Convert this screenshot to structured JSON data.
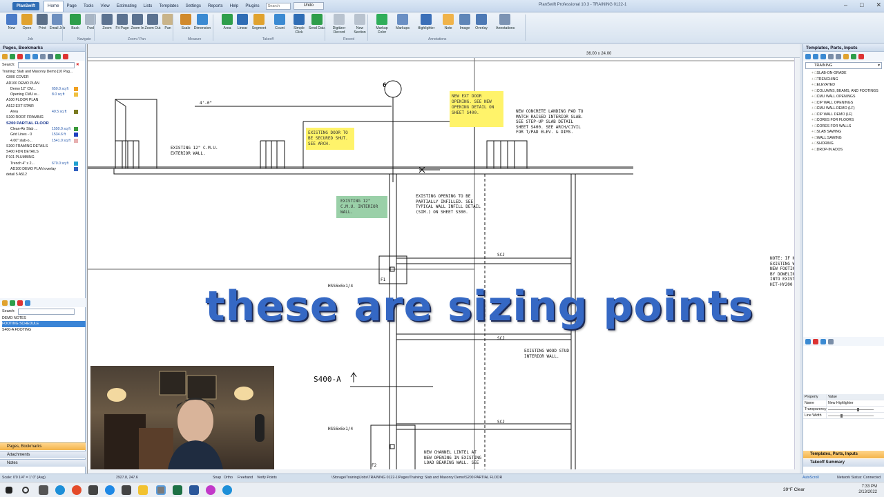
{
  "window": {
    "app_button": "PlanSwift",
    "title": "PlanSwift Professional 10.3 - TRAINING 0122-1",
    "menu": [
      "Home",
      "Page",
      "Tools",
      "View",
      "Estimating",
      "Lists",
      "Templates",
      "Settings",
      "Reports",
      "Help",
      "Plugins"
    ],
    "search_placeholder": "Search",
    "undo_label": "Undo"
  },
  "ribbon": {
    "buttons": [
      {
        "label": "New",
        "color": "#4a7bc8"
      },
      {
        "label": "Open",
        "color": "#e0a22e"
      },
      {
        "label": "Print",
        "color": "#5b6f88"
      },
      {
        "label": "Email Job",
        "color": "#6d8fbf"
      },
      {
        "label": "Back",
        "color": "#2e9e4a"
      },
      {
        "label": "Fwd",
        "color": "#a9b6c5"
      },
      {
        "label": "Zoom",
        "color": "#5b7290"
      },
      {
        "label": "Fit Page",
        "color": "#5b7290"
      },
      {
        "label": "Zoom In",
        "color": "#5b7290"
      },
      {
        "label": "Zoom Out",
        "color": "#5b7290"
      },
      {
        "label": "Pan",
        "color": "#c9b48a"
      },
      {
        "label": "Scale",
        "color": "#d18a2c"
      },
      {
        "label": "Dimension",
        "color": "#3b8ad2"
      },
      {
        "label": "Area",
        "color": "#2e9e4a"
      },
      {
        "label": "Linear",
        "color": "#2f6db5"
      },
      {
        "label": "Segment",
        "color": "#e0a22e"
      },
      {
        "label": "Count",
        "color": "#3b8ad2"
      },
      {
        "label": "Simple Click",
        "color": "#2f6db5"
      },
      {
        "label": "Send Data",
        "color": "#2e9e4a"
      },
      {
        "label": "Digitizer Record",
        "color": "#b9c3cf"
      },
      {
        "label": "New Section",
        "color": "#b9c3cf"
      },
      {
        "label": "Markup Color",
        "color": "#2fae5a"
      },
      {
        "label": "Markups",
        "color": "#6a8fc4"
      },
      {
        "label": "Highlighter",
        "color": "#3b6fb8"
      },
      {
        "label": "Note",
        "color": "#f0b34a"
      },
      {
        "label": "Image",
        "color": "#5f86b8"
      },
      {
        "label": "Overlay",
        "color": "#4d79b5"
      },
      {
        "label": "Annotations",
        "color": "#7c93b3"
      }
    ],
    "groups": [
      "Job",
      "Navigate",
      "Zoom / Pan",
      "Measure",
      "Takeoff",
      "Record",
      "Annotations"
    ]
  },
  "left_panel": {
    "title": "Pages, Bookmarks",
    "search_label": "Search:",
    "tree": [
      {
        "text": "Training: Slab and Masonry Demo [10 Pag...",
        "qty": "",
        "style": "normal",
        "indent": 0,
        "color": ""
      },
      {
        "text": "G000 COVER",
        "qty": "",
        "style": "normal",
        "indent": 2,
        "color": ""
      },
      {
        "text": "AD100 DEMO PLAN",
        "qty": "",
        "style": "normal",
        "indent": 2,
        "color": ""
      },
      {
        "text": "Demo 12\" CM...",
        "qty": "650.0 sq ft",
        "style": "normal",
        "indent": 4,
        "color": "#f0a020"
      },
      {
        "text": "Opening CMU w...",
        "qty": "8.0 sq ft",
        "style": "normal",
        "indent": 4,
        "color": "#f0c040"
      },
      {
        "text": "A100 FLOOR PLAN",
        "qty": "",
        "style": "normal",
        "indent": 2,
        "color": ""
      },
      {
        "text": "A512 EXT STAIR",
        "qty": "",
        "style": "normal",
        "indent": 2,
        "color": ""
      },
      {
        "text": "Area",
        "qty": "40.5 sq ft",
        "style": "normal",
        "indent": 4,
        "color": "#7a7a20"
      },
      {
        "text": "S100 ROOF FRAMING",
        "qty": "",
        "style": "normal",
        "indent": 2,
        "color": ""
      },
      {
        "text": "S200 PARTIAL FLOOR",
        "qty": "",
        "style": "bold",
        "indent": 2,
        "color": ""
      },
      {
        "text": "Clean-Air Slab ...",
        "qty": "1550.0 sq ft",
        "style": "normal",
        "indent": 4,
        "color": "#3a9a3a"
      },
      {
        "text": "Grid Lines - 0",
        "qty": "1534.6 ft",
        "style": "normal",
        "indent": 4,
        "color": "#2040c0"
      },
      {
        "text": "4.00\" slab-o...",
        "qty": "1541.0 sq ft",
        "style": "normal",
        "indent": 4,
        "color": "#e8b0b0"
      },
      {
        "text": "S300 FRAMING DETAILS",
        "qty": "",
        "style": "normal",
        "indent": 2,
        "color": ""
      },
      {
        "text": "S400 FDN DETAILS",
        "qty": "",
        "style": "normal",
        "indent": 2,
        "color": ""
      },
      {
        "text": "P101 PLUMBING",
        "qty": "",
        "style": "normal",
        "indent": 2,
        "color": ""
      },
      {
        "text": "Trench 4\" x 2...",
        "qty": "670.0 sq ft",
        "style": "normal",
        "indent": 4,
        "color": "#20a0d0"
      },
      {
        "text": "AD100 DEMO PLAN overlay",
        "qty": "",
        "style": "normal",
        "indent": 4,
        "color": "#3060c0"
      },
      {
        "text": "detail 5 A512",
        "qty": "",
        "style": "normal",
        "indent": 2,
        "color": ""
      }
    ],
    "lower_search_label": "Search:",
    "lower_items": [
      "DEMO NOTES",
      "FOOTING SCHEDULE",
      "S400-A FOOTING"
    ],
    "accordion": [
      "Pages, Bookmarks",
      "Attachments",
      "Notes"
    ]
  },
  "canvas": {
    "page_size": "36.00 x 24.00",
    "grid_marker": "6",
    "dim_text": "4'-0\"",
    "notes_yellow": [
      {
        "text": "EXISTING DOOR TO\nBE SECURED SHUT.\nSEE ARCH."
      },
      {
        "text": "NEW EXT DOOR\nOPENING. SEE NEW\nOPENING DETAIL\nON SHEET S400."
      }
    ],
    "note_green": "EXISTING 12\" C.M.U.\nINTERIOR WALL.",
    "labels": [
      "EXISTING 12\" C.M.U.\nEXTERIOR WALL.",
      "NEW CONCRETE LANDING PAD TO\nMATCH RAISED INTERIOR SLAB.\nSEE STEP-UP SLAB DETAIL\nSHEET S400. SEE ARCH/CIVIL\nFOR T/PAD ELEV. & DIMS.",
      "EXISTING OPENING TO BE\nPARTIALLY INFILLED. SEE\nTYPICAL WALL INFILL DETAIL\n(SIM.) ON SHEET S300.",
      "SCJ",
      "HSS6x6x1/4",
      "F1",
      "SCJ",
      "EXISTING WOOD STUD\nINTERIOR WALL.",
      "S400-A",
      "SCJ",
      "HSS6x6x1/4",
      "NEW CHANNEL LINTEL AT\nNEW OPENING IN EXISTING\nLOAD BEARING WALL. SEE",
      "F2",
      "NOTE: IF N\nEXISTING W\nNEW FOOTIN\nBY DOWELIN\nINTO EXISTI\nHIT-HY200"
    ],
    "caption": "these are sizing points"
  },
  "right_panel": {
    "title": "Templates, Parts, Inputs",
    "dropdown": "TRAINING",
    "tree": [
      "SLAB-ON-GRADE",
      "TRENCHING",
      "ELEVATED",
      "COLUMNS, BEAMS, AND FOOTINGS",
      "CMU WALL OPENINGS",
      "CIP WALL OPENINGS",
      "CMU WALL DEMO (LF)",
      "CIP WALL DEMO (LF)",
      "CORES FOR FLOORS",
      "CORES FOR WALLS",
      "SLAB SAWING",
      "WALL SAWING",
      "SHORING",
      "DROP-IN ADDS"
    ],
    "prop_header": [
      "Property",
      "Value"
    ],
    "props": [
      {
        "name": "Name",
        "value": "New Highlighter"
      },
      {
        "name": "Transparency",
        "value": ""
      },
      {
        "name": "Line Width",
        "value": ""
      }
    ],
    "accordion": [
      "Templates, Parts, Inputs",
      "Takeoff Summary"
    ]
  },
  "status_bar": {
    "scale": "Scale: 0'0 1/4\" = 1' 0\" (Avg)",
    "coords": "2927.8, 247.6",
    "toggles": [
      "Snap",
      "Ortho",
      "Freehand",
      "Verify Points"
    ],
    "path": "\\Storage\\Training\\Jobs\\TRAINING 0122-1\\Pages\\Training: Slab and Masonry Demo\\S200 PARTIAL FLOOR",
    "autoscroll": "AutoScroll",
    "network": "Network Status: Connected"
  },
  "taskbar": {
    "weather": "39°F  Clear",
    "time": "7:33 PM",
    "date": "2/13/2022"
  }
}
